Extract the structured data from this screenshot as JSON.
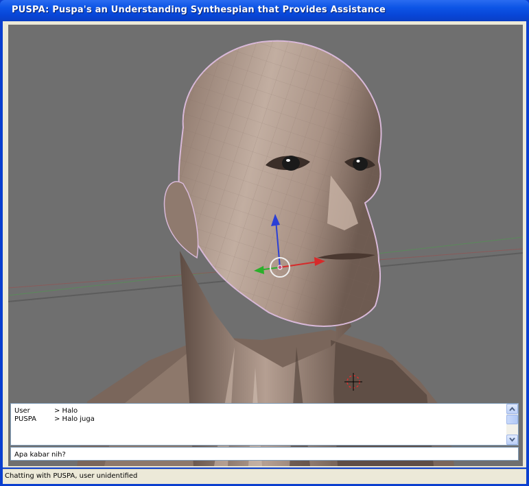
{
  "window": {
    "title": "PUSPA: Puspa's an Understanding Synthespian that Provides Assistance"
  },
  "viewport": {
    "content": "3D head model",
    "background_color": "#6f6f6f",
    "skin_color": "#b59f92",
    "gizmo_axes": [
      "z-axis-blue",
      "x-axis-red",
      "y-axis-green"
    ]
  },
  "chat": {
    "lines": [
      {
        "speaker": "User",
        "message": "> Halo"
      },
      {
        "speaker": "PUSPA",
        "message": "> Halo juga"
      }
    ],
    "input_value": "Apa kabar nih?"
  },
  "status": {
    "text": "Chatting with PUSPA, user unidentified"
  },
  "colors": {
    "titlebar": "#0a3fcf",
    "frame": "#ece9d8",
    "border": "#7f9db9"
  }
}
